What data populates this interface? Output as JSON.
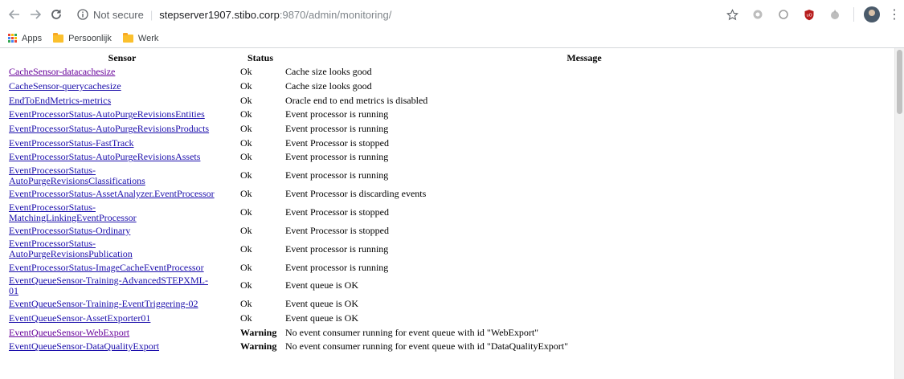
{
  "browser": {
    "security_label": "Not secure",
    "url_host": "stepserver1907.stibo.corp",
    "url_rest": ":9870/admin/monitoring/",
    "bookmarks": [
      "Apps",
      "Persoonlijk",
      "Werk"
    ]
  },
  "table": {
    "headers": {
      "sensor": "Sensor",
      "status": "Status",
      "message": "Message"
    },
    "rows": [
      {
        "sensor": "CacheSensor-datacachesize",
        "status": "Ok",
        "message": "Cache size looks good",
        "visited": true
      },
      {
        "sensor": "CacheSensor-querycachesize",
        "status": "Ok",
        "message": "Cache size looks good",
        "visited": false
      },
      {
        "sensor": "EndToEndMetrics-metrics",
        "status": "Ok",
        "message": "Oracle end to end metrics is disabled",
        "visited": false
      },
      {
        "sensor": "EventProcessorStatus-AutoPurgeRevisionsEntities",
        "status": "Ok",
        "message": "Event processor is running",
        "visited": false
      },
      {
        "sensor": "EventProcessorStatus-AutoPurgeRevisionsProducts",
        "status": "Ok",
        "message": "Event processor is running",
        "visited": false
      },
      {
        "sensor": "EventProcessorStatus-FastTrack",
        "status": "Ok",
        "message": "Event Processor is stopped",
        "visited": false
      },
      {
        "sensor": "EventProcessorStatus-AutoPurgeRevisionsAssets",
        "status": "Ok",
        "message": "Event processor is running",
        "visited": false
      },
      {
        "sensor_lines": [
          "EventProcessorStatus-",
          "AutoPurgeRevisionsClassifications"
        ],
        "status": "Ok",
        "message": "Event processor is running",
        "visited": false
      },
      {
        "sensor": "EventProcessorStatus-AssetAnalyzer.EventProcessor",
        "status": "Ok",
        "message": "Event Processor is discarding events",
        "visited": false
      },
      {
        "sensor_lines": [
          "EventProcessorStatus-",
          "MatchingLinkingEventProcessor"
        ],
        "status": "Ok",
        "message": "Event Processor is stopped",
        "visited": false
      },
      {
        "sensor": "EventProcessorStatus-Ordinary",
        "status": "Ok",
        "message": "Event Processor is stopped",
        "visited": false
      },
      {
        "sensor_lines": [
          "EventProcessorStatus-",
          "AutoPurgeRevisionsPublication"
        ],
        "status": "Ok",
        "message": "Event processor is running",
        "visited": false
      },
      {
        "sensor": "EventProcessorStatus-ImageCacheEventProcessor",
        "status": "Ok",
        "message": "Event processor is running",
        "visited": false
      },
      {
        "sensor_lines": [
          "EventQueueSensor-Training-AdvancedSTEPXML-",
          "01"
        ],
        "status": "Ok",
        "message": "Event queue is OK",
        "visited": false
      },
      {
        "sensor": "EventQueueSensor-Training-EventTriggering-02",
        "status": "Ok",
        "message": "Event queue is OK",
        "visited": false
      },
      {
        "sensor": "EventQueueSensor-AssetExporter01",
        "status": "Ok",
        "message": "Event queue is OK",
        "visited": false
      },
      {
        "sensor": "EventQueueSensor-WebExport",
        "status": "Warning",
        "message": "No event consumer running for event queue with id \"WebExport\"",
        "visited": true
      },
      {
        "sensor": "EventQueueSensor-DataQualityExport",
        "status": "Warning",
        "message": "No event consumer running for event queue with id \"DataQualityExport\"",
        "visited": false
      }
    ]
  },
  "colors": {
    "link": "#1a0dab",
    "visited": "#660099"
  },
  "icons": [
    "back-arrow-icon",
    "forward-arrow-icon",
    "reload-icon",
    "info-icon",
    "star-icon",
    "apps-grid-icon",
    "folder-icon",
    "kebab-menu-icon"
  ]
}
